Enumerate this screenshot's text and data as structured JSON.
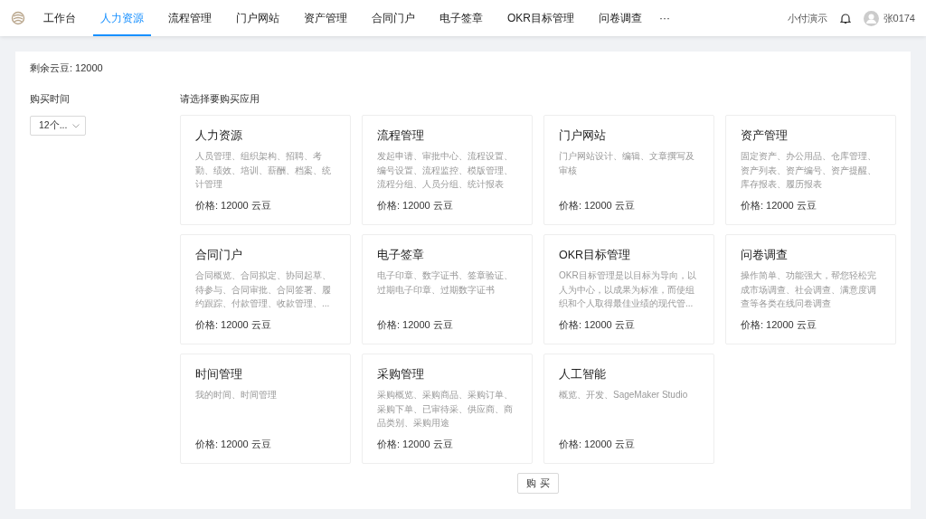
{
  "nav": {
    "items": [
      {
        "label": "工作台",
        "selected": false
      },
      {
        "label": "人力资源",
        "selected": true
      },
      {
        "label": "流程管理",
        "selected": false
      },
      {
        "label": "门户网站",
        "selected": false
      },
      {
        "label": "资产管理",
        "selected": false
      },
      {
        "label": "合同门户",
        "selected": false
      },
      {
        "label": "电子签章",
        "selected": false
      },
      {
        "label": "OKR目标管理",
        "selected": false
      },
      {
        "label": "问卷调查",
        "selected": false
      }
    ],
    "more": "···",
    "org": "小付演示",
    "user": "张0174"
  },
  "balance": "剩余云豆: 12000",
  "period": {
    "label": "购买时间",
    "value": "12个..."
  },
  "apps_label": "请选择要购买应用",
  "apps": [
    {
      "title": "人力资源",
      "desc": "人员管理、组织架构、招聘、考勤、绩效、培训、薪酬、档案、统计管理",
      "price": "价格: 12000 云豆"
    },
    {
      "title": "流程管理",
      "desc": "发起申请、审批中心、流程设置、编号设置、流程监控、模版管理、流程分组、人员分组、统计报表",
      "price": "价格: 12000 云豆"
    },
    {
      "title": "门户网站",
      "desc": "门户网站设计、编辑、文章撰写及审核",
      "price": "价格: 12000 云豆"
    },
    {
      "title": "资产管理",
      "desc": "固定资产、办公用品、仓库管理、资产列表、资产编号、资产提醒、库存报表、履历报表",
      "price": "价格: 12000 云豆"
    },
    {
      "title": "合同门户",
      "desc": "合同概览、合同拟定、协同起草、待参与、合同审批、合同签署、履约跟踪、付款管理、收款管理、...",
      "price": "价格: 12000 云豆"
    },
    {
      "title": "电子签章",
      "desc": "电子印章、数字证书、签章验证、过期电子印章、过期数字证书",
      "price": "价格: 12000 云豆"
    },
    {
      "title": "OKR目标管理",
      "desc": "OKR目标管理是以目标为导向，以人为中心，以成果为标准，而使组织和个人取得最佳业绩的现代管...",
      "price": "价格: 12000 云豆"
    },
    {
      "title": "问卷调查",
      "desc": "操作简单、功能强大，帮您轻松完成市场调查、社会调查、满意度调查等各类在线问卷调查",
      "price": "价格: 12000 云豆"
    },
    {
      "title": "时间管理",
      "desc": "我的时间、时间管理",
      "price": "价格: 12000 云豆"
    },
    {
      "title": "采购管理",
      "desc": "采购概览、采购商品、采购订单、采购下单、已审待采、供应商、商品类别、采购用途",
      "price": "价格: 12000 云豆"
    },
    {
      "title": "人工智能",
      "desc": "概览、开发、SageMaker Studio",
      "price": "价格: 12000 云豆"
    }
  ],
  "buy_button": "购 买"
}
